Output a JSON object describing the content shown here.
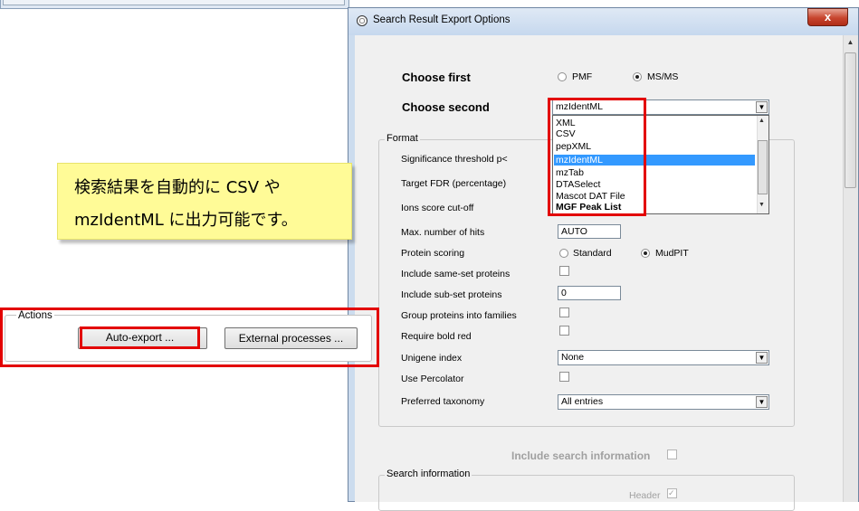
{
  "dialog": {
    "title": "Search Result Export Options",
    "close_label": "x"
  },
  "choose_first": {
    "label": "Choose first",
    "options": [
      "PMF",
      "MS/MS"
    ],
    "selected": "MS/MS"
  },
  "choose_second": {
    "label": "Choose second",
    "value": "mzIdentML",
    "list": [
      "XML",
      "CSV",
      "pepXML",
      "mzIdentML",
      "mzTab",
      "DTASelect",
      "Mascot DAT File",
      "MGF Peak List"
    ],
    "highlighted": "mzIdentML"
  },
  "format": {
    "title": "Format",
    "significance_label": "Significance threshold p<",
    "fdr_label": "Target FDR (percentage)",
    "ions_label": "Ions score cut-off",
    "max_hits_label": "Max. number of hits",
    "max_hits_value": "AUTO",
    "protein_scoring_label": "Protein scoring",
    "scoring_options": [
      "Standard",
      "MudPIT"
    ],
    "scoring_selected": "MudPIT",
    "same_set_label": "Include same-set proteins",
    "sub_set_label": "Include sub-set proteins",
    "sub_set_value": "0",
    "families_label": "Group proteins into families",
    "bold_red_label": "Require bold red",
    "unigene_label": "Unigene index",
    "unigene_value": "None",
    "percolator_label": "Use Percolator",
    "taxonomy_label": "Preferred taxonomy",
    "taxonomy_value": "All entries"
  },
  "search_info": {
    "include_label": "Include search information",
    "group_title": "Search information",
    "header_label": "Header"
  },
  "callout": {
    "line1": "検索結果を自動的に CSV や",
    "line2": "mzIdentML に出力可能です。"
  },
  "actions": {
    "title": "Actions",
    "auto_export": "Auto-export ...",
    "external_processes": "External processes ..."
  },
  "colors": {
    "highlight_red": "#e30000",
    "selection_blue": "#3399ff",
    "callout_yellow": "#fffb97"
  }
}
